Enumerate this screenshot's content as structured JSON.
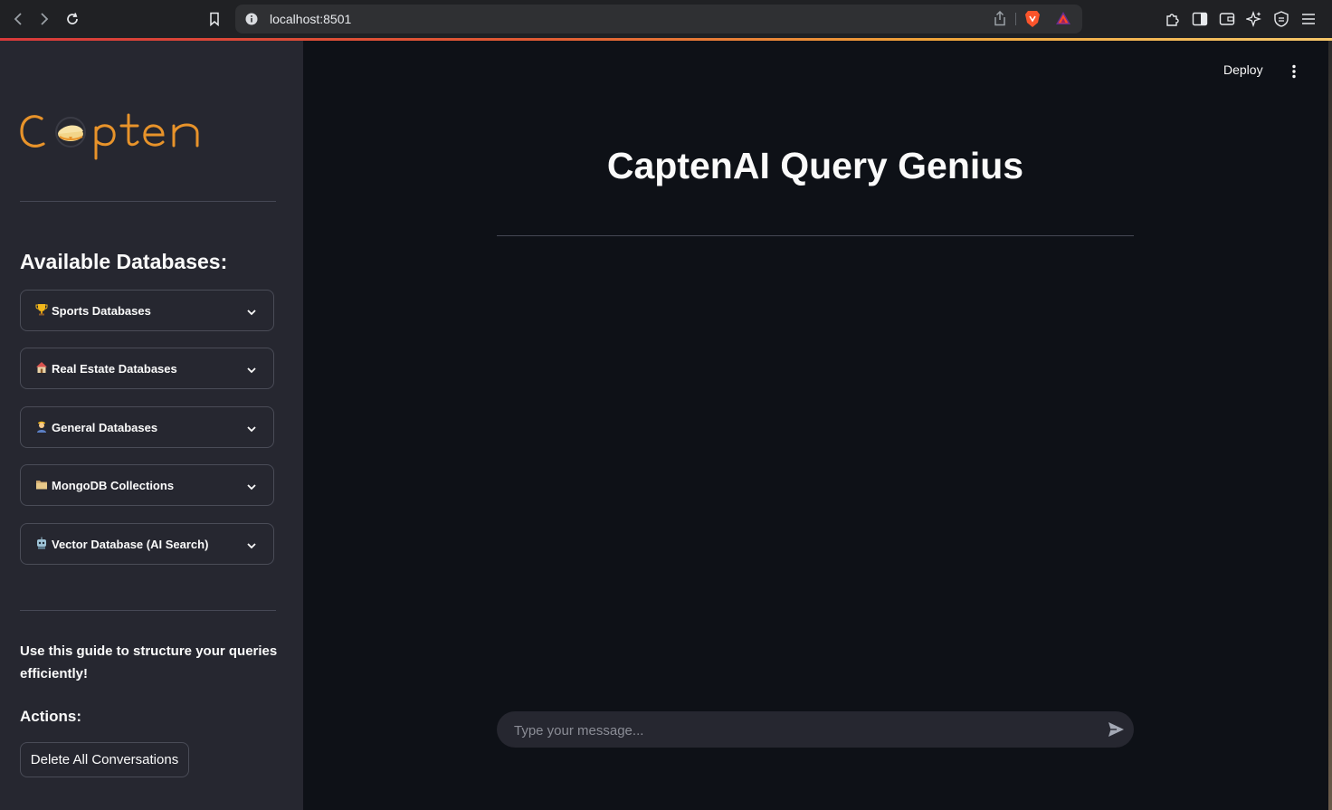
{
  "browser": {
    "url": "localhost:8501"
  },
  "sidebar": {
    "logo_text": "Capten",
    "heading": "Available Databases:",
    "expanders": [
      {
        "label": "Sports Databases",
        "icon": "trophy-icon"
      },
      {
        "label": "Real Estate Databases",
        "icon": "house-icon"
      },
      {
        "label": "General Databases",
        "icon": "person-icon"
      },
      {
        "label": "MongoDB Collections",
        "icon": "folder-icon"
      },
      {
        "label": "Vector Database (AI Search)",
        "icon": "robot-icon"
      }
    ],
    "guide_text": "Use this guide to structure your queries efficiently!",
    "actions_heading": "Actions:",
    "delete_button": "Delete All Conversations"
  },
  "main": {
    "deploy_label": "Deploy",
    "title": "CaptenAI Query Genius",
    "chat_placeholder": "Type your message..."
  },
  "colors": {
    "main_bg": "#0e1117",
    "sidebar_bg": "#262730",
    "logo_orange": "#e8932a"
  }
}
